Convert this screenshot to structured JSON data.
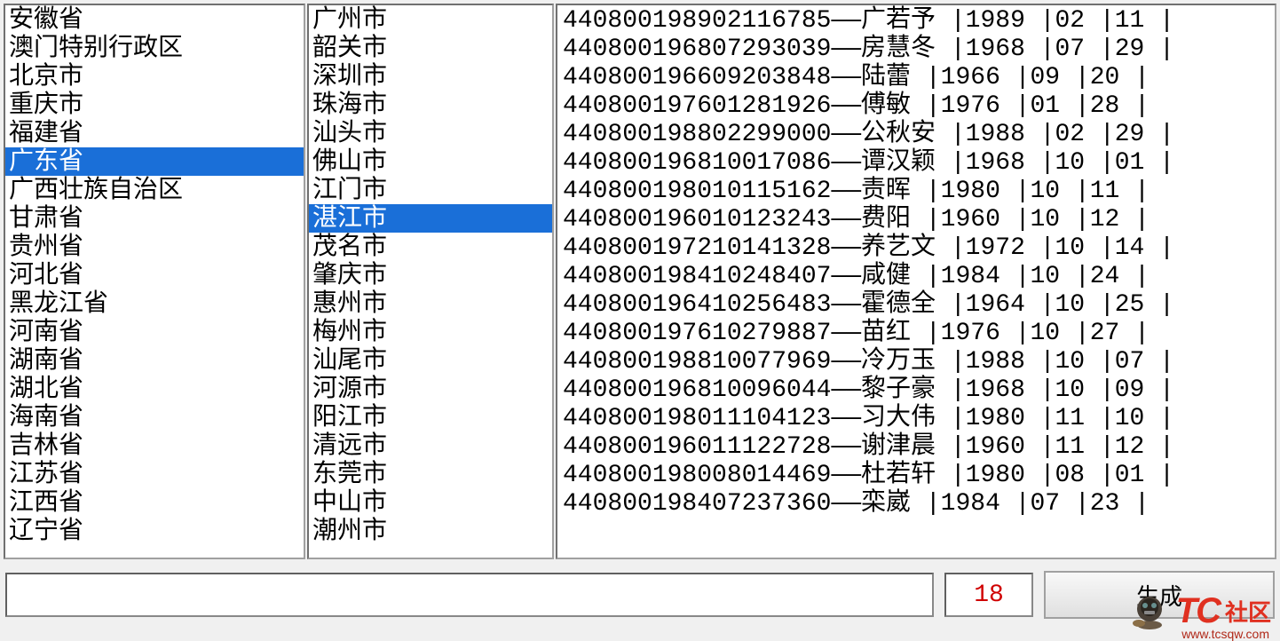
{
  "provinces": {
    "items": [
      "安徽省",
      "澳门特别行政区",
      "北京市",
      "重庆市",
      "福建省",
      "广东省",
      "广西壮族自治区",
      "甘肃省",
      "贵州省",
      "河北省",
      "黑龙江省",
      "河南省",
      "湖南省",
      "湖北省",
      "海南省",
      "吉林省",
      "江苏省",
      "江西省",
      "辽宁省"
    ],
    "selected_index": 5
  },
  "cities": {
    "items": [
      "广州市",
      "韶关市",
      "深圳市",
      "珠海市",
      "汕头市",
      "佛山市",
      "江门市",
      "湛江市",
      "茂名市",
      "肇庆市",
      "惠州市",
      "梅州市",
      "汕尾市",
      "河源市",
      "阳江市",
      "清远市",
      "东莞市",
      "中山市",
      "潮州市"
    ],
    "selected_index": 7
  },
  "results": [
    {
      "id": "440800198902116785",
      "sep": "——",
      "name": "广若予",
      "year": "1989",
      "month": "02",
      "day": "11"
    },
    {
      "id": "440800196807293039",
      "sep": "——",
      "name": "房慧冬",
      "year": "1968",
      "month": "07",
      "day": "29"
    },
    {
      "id": "440800196609203848",
      "sep": "——",
      "name": "陆蕾",
      "year": "1966",
      "month": "09",
      "day": "20"
    },
    {
      "id": "440800197601281926",
      "sep": "——",
      "name": "傅敏",
      "year": "1976",
      "month": "01",
      "day": "28"
    },
    {
      "id": "440800198802299000",
      "sep": "——",
      "name": "公秋安",
      "year": "1988",
      "month": "02",
      "day": "29"
    },
    {
      "id": "440800196810017086",
      "sep": "——",
      "name": "谭汉颖",
      "year": "1968",
      "month": "10",
      "day": "01"
    },
    {
      "id": "440800198010115162",
      "sep": "——",
      "name": "责晖",
      "year": "1980",
      "month": "10",
      "day": "11"
    },
    {
      "id": "440800196010123243",
      "sep": "——",
      "name": "费阳",
      "year": "1960",
      "month": "10",
      "day": "12"
    },
    {
      "id": "440800197210141328",
      "sep": "——",
      "name": "养艺文",
      "year": "1972",
      "month": "10",
      "day": "14"
    },
    {
      "id": "440800198410248407",
      "sep": "——",
      "name": "咸健",
      "year": "1984",
      "month": "10",
      "day": "24"
    },
    {
      "id": "440800196410256483",
      "sep": "——",
      "name": "霍德全",
      "year": "1964",
      "month": "10",
      "day": "25"
    },
    {
      "id": "440800197610279887",
      "sep": "——",
      "name": "苗红",
      "year": "1976",
      "month": "10",
      "day": "27"
    },
    {
      "id": "440800198810077969",
      "sep": "——",
      "name": "冷万玉",
      "year": "1988",
      "month": "10",
      "day": "07"
    },
    {
      "id": "440800196810096044",
      "sep": "——",
      "name": "黎子豪",
      "year": "1968",
      "month": "10",
      "day": "09"
    },
    {
      "id": "440800198011104123",
      "sep": "——",
      "name": "习大伟",
      "year": "1980",
      "month": "11",
      "day": "10"
    },
    {
      "id": "440800196011122728",
      "sep": "——",
      "name": "谢津晨",
      "year": "1960",
      "month": "11",
      "day": "12"
    },
    {
      "id": "440800198008014469",
      "sep": "——",
      "name": "杜若轩",
      "year": "1980",
      "month": "08",
      "day": "01"
    },
    {
      "id": "440800198407237360",
      "sep": "——",
      "name": "栾崴",
      "year": "1984",
      "month": "07",
      "day": "23"
    }
  ],
  "bottom": {
    "input_value": "",
    "count_value": "18",
    "button_label": "生成"
  },
  "watermark": {
    "logo": "TC",
    "cn": "社区",
    "url": "www.tcsqw.com"
  }
}
